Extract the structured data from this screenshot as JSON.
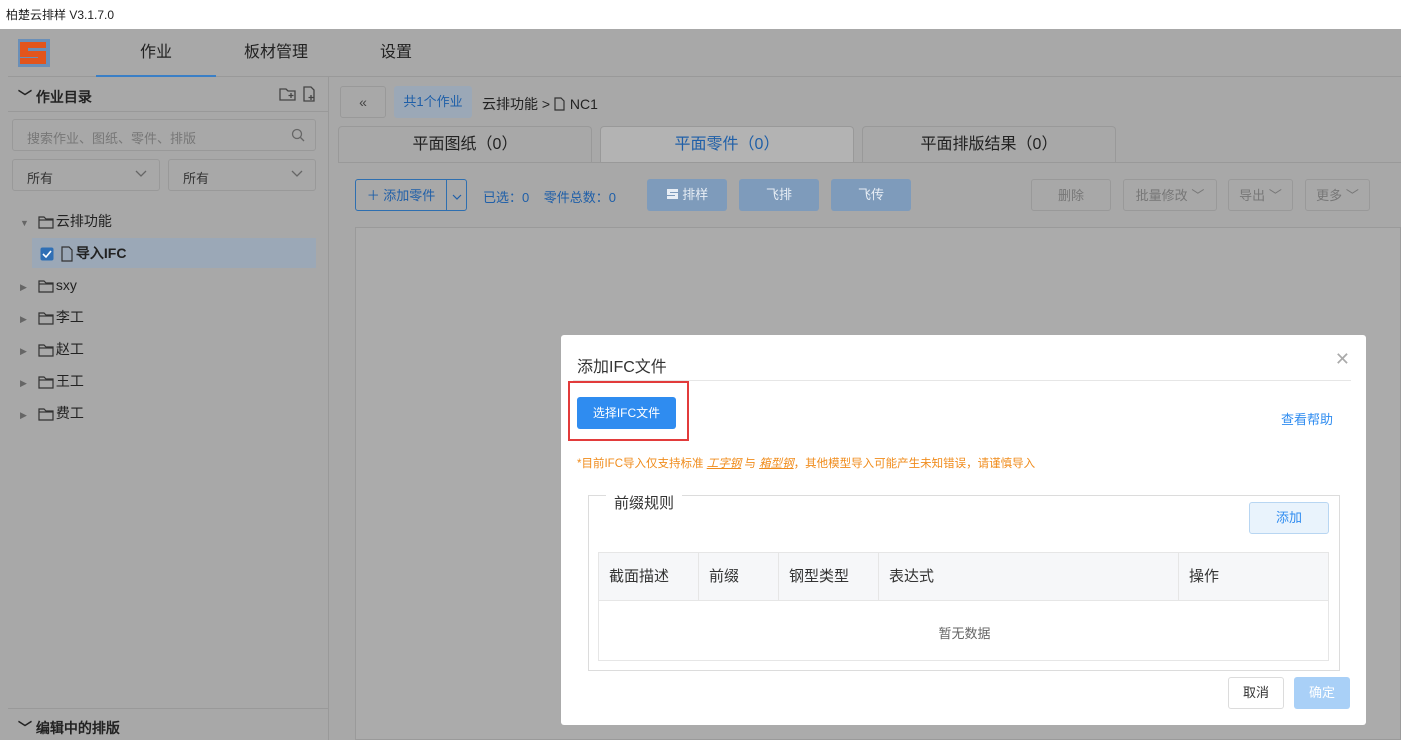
{
  "window": {
    "title": "柏楚云排样 V3.1.7.0"
  },
  "topnav": {
    "tabs": [
      "作业",
      "板材管理",
      "设置"
    ],
    "active_index": 0
  },
  "sidebar": {
    "title": "作业目录",
    "search_placeholder": "搜索作业、图纸、零件、排版",
    "filter1": "所有",
    "filter2": "所有",
    "tree": [
      {
        "label": "云排功能",
        "expanded": true
      },
      {
        "label": "导入IFC",
        "checked": true,
        "child": true
      },
      {
        "label": "sxy"
      },
      {
        "label": "李工"
      },
      {
        "label": "赵工"
      },
      {
        "label": "王工"
      },
      {
        "label": "费工"
      }
    ],
    "footer_title": "编辑中的排版"
  },
  "main": {
    "back_label": "«",
    "count_label": "共1个作业",
    "breadcrumb_folder": "云排功能",
    "breadcrumb_sep": ">",
    "breadcrumb_file": "NC1",
    "tabs": [
      "平面图纸（0）",
      "平面零件（0）",
      "平面排版结果（0）"
    ],
    "active_tab": 1,
    "toolbar": {
      "add_part": "＋ 添加零件",
      "selected": "已选：0",
      "total": "零件总数：0",
      "nest": "排样",
      "fly_nest": "飞排",
      "fly_upload": "飞传",
      "delete": "删除",
      "batch_edit": "批量修改",
      "export": "导出",
      "more": "更多"
    }
  },
  "modal": {
    "title": "添加IFC文件",
    "choose_button": "选择IFC文件",
    "help_link": "查看帮助",
    "warning_prefix": "*目前IFC导入仅支持标准",
    "warning_link1": "工字钢",
    "warning_mid": "与",
    "warning_link2": "箱型钢",
    "warning_suffix": "，其他模型导入可能产生未知错误，请谨慎导入",
    "section_title": "前缀规则",
    "add_button": "添加",
    "columns": [
      "截面描述",
      "前缀",
      "钢型类型",
      "表达式",
      "操作"
    ],
    "empty_text": "暂无数据",
    "cancel": "取消",
    "confirm": "确定"
  }
}
